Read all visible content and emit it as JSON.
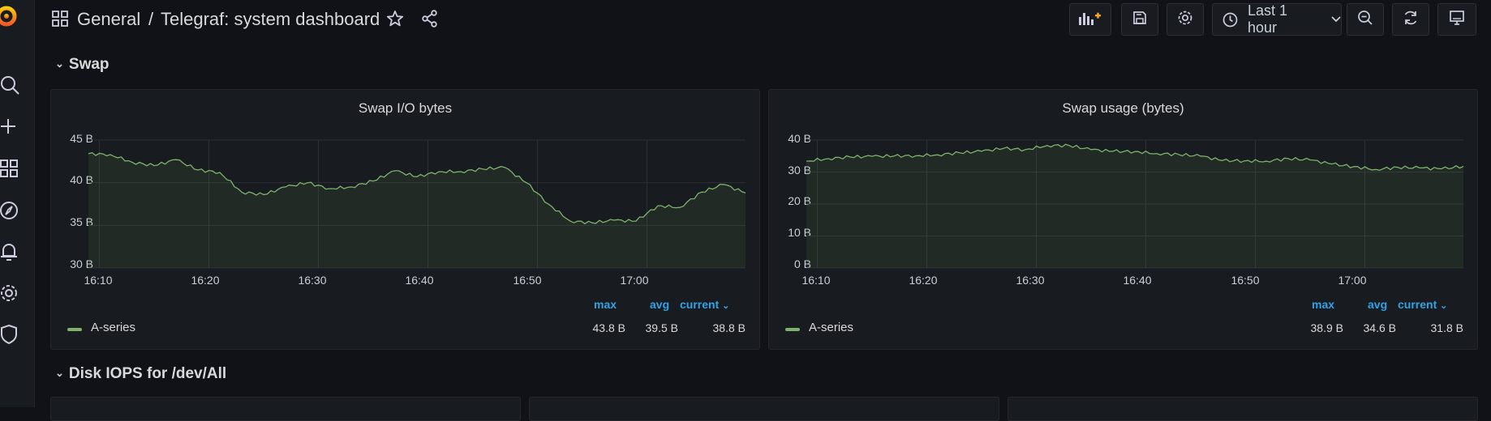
{
  "breadcrumb": {
    "folder": "General",
    "separator": "/",
    "dashboard": "Telegraf: system dashboard"
  },
  "toolbar": {
    "time_range": "Last 1 hour"
  },
  "rows": [
    {
      "title": "Swap"
    },
    {
      "title": "Disk IOPS for /dev/All"
    }
  ],
  "icons": {
    "logo": "grafana-logo-icon",
    "search": "search-icon",
    "create": "plus-icon",
    "dashboards": "grid-icon",
    "explore": "compass-icon",
    "alerting": "bell-icon",
    "config": "gear-icon",
    "admin": "shield-icon"
  },
  "colors": {
    "series": "#7eb26d",
    "legend_header": "#33a2e5",
    "background": "#111217",
    "panel": "#181b1f"
  },
  "panels": [
    {
      "title": "Swap I/O bytes",
      "legend": {
        "headers": {
          "max": "max",
          "avg": "avg",
          "current": "current"
        },
        "series_name": "A-series",
        "max": "43.8 B",
        "avg": "39.5 B",
        "current": "38.8 B"
      },
      "chart_data": {
        "type": "area",
        "title": "Swap I/O bytes",
        "y_ticks": [
          "45 B",
          "40 B",
          "35 B",
          "30 B"
        ],
        "ylim": [
          30,
          45
        ],
        "x_ticks": [
          "16:10",
          "16:20",
          "16:30",
          "16:40",
          "16:50",
          "17:00"
        ],
        "xlim_minutes": [
          "16:09",
          "17:09"
        ],
        "series": [
          {
            "name": "A-series",
            "x": [
              "16:09",
              "16:11",
              "16:13",
              "16:15",
              "16:17",
              "16:19",
              "16:21",
              "16:23",
              "16:25",
              "16:27",
              "16:29",
              "16:31",
              "16:33",
              "16:35",
              "16:37",
              "16:39",
              "16:41",
              "16:43",
              "16:45",
              "16:47",
              "16:49",
              "16:51",
              "16:53",
              "16:55",
              "16:57",
              "16:59",
              "17:01",
              "17:03",
              "17:05",
              "17:07",
              "17:09"
            ],
            "values": [
              43.4,
              43.3,
              42.4,
              42.0,
              42.7,
              41.5,
              41.2,
              38.9,
              38.6,
              39.5,
              40.0,
              39.3,
              39.5,
              40.2,
              41.4,
              40.7,
              41.3,
              41.3,
              41.6,
              41.8,
              40.0,
              37.5,
              35.5,
              35.3,
              35.6,
              35.5,
              37.3,
              37.1,
              38.9,
              39.8,
              38.8
            ]
          }
        ]
      }
    },
    {
      "title": "Swap usage (bytes)",
      "legend": {
        "headers": {
          "max": "max",
          "avg": "avg",
          "current": "current"
        },
        "series_name": "A-series",
        "max": "38.9 B",
        "avg": "34.6 B",
        "current": "31.8 B"
      },
      "chart_data": {
        "type": "area",
        "title": "Swap usage (bytes)",
        "y_ticks": [
          "40 B",
          "30 B",
          "20 B",
          "10 B",
          "0 B"
        ],
        "ylim": [
          0,
          40
        ],
        "x_ticks": [
          "16:10",
          "16:20",
          "16:30",
          "16:40",
          "16:50",
          "17:00"
        ],
        "xlim_minutes": [
          "16:09",
          "17:09"
        ],
        "series": [
          {
            "name": "A-series",
            "x": [
              "16:09",
              "16:11",
              "16:13",
              "16:15",
              "16:17",
              "16:19",
              "16:21",
              "16:23",
              "16:25",
              "16:27",
              "16:29",
              "16:31",
              "16:33",
              "16:35",
              "16:37",
              "16:39",
              "16:41",
              "16:43",
              "16:45",
              "16:47",
              "16:49",
              "16:51",
              "16:53",
              "16:55",
              "16:57",
              "16:59",
              "17:01",
              "17:03",
              "17:05",
              "17:07",
              "17:09"
            ],
            "values": [
              33.4,
              34.2,
              34.7,
              34.9,
              35.0,
              35.1,
              35.4,
              36.0,
              36.5,
              37.4,
              37.0,
              38.3,
              38.3,
              37.0,
              36.5,
              36.4,
              35.8,
              35.5,
              35.0,
              33.6,
              33.5,
              33.4,
              34.2,
              33.8,
              32.5,
              31.7,
              30.8,
              31.5,
              31.3,
              31.0,
              31.8
            ]
          }
        ]
      }
    }
  ]
}
